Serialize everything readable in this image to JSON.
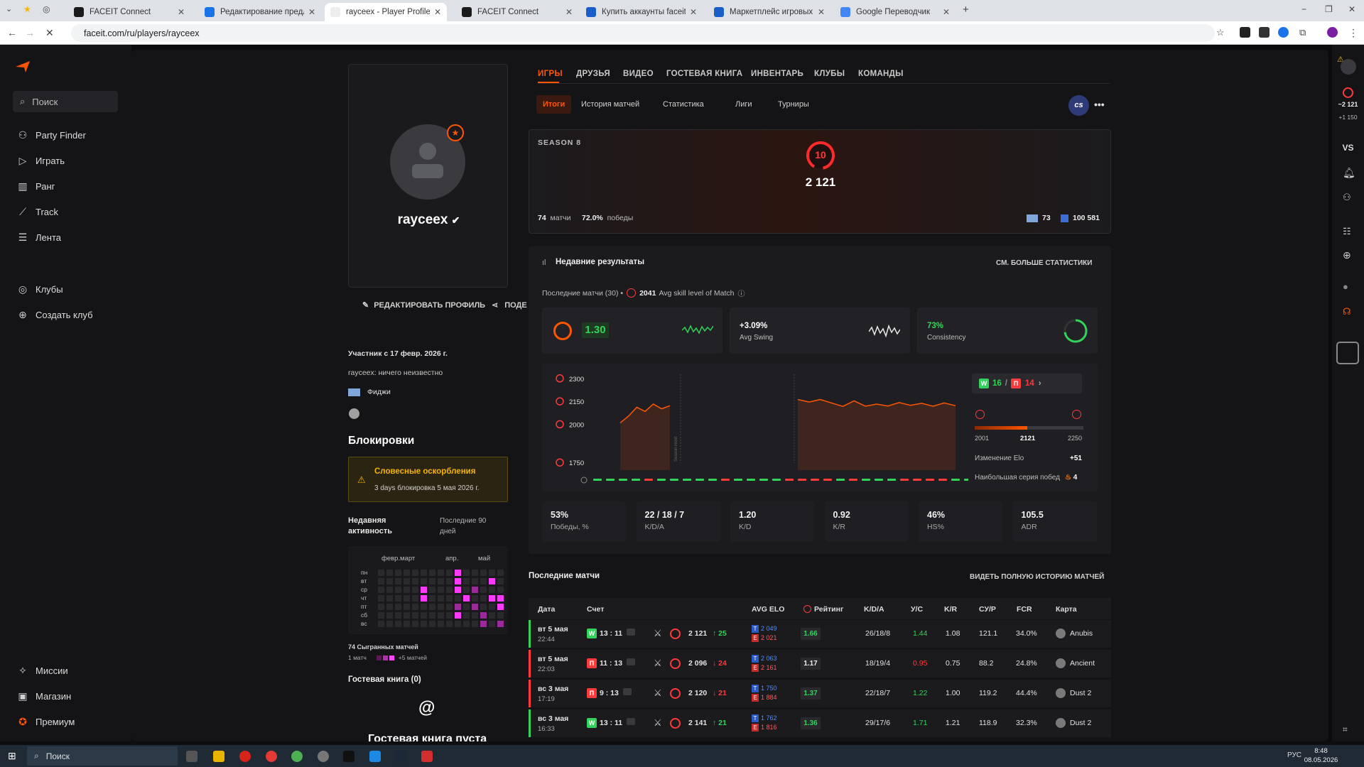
{
  "browser": {
    "tabs": [
      {
        "title": "FACEIT Connect",
        "active": false
      },
      {
        "title": "Редактирование предложения",
        "active": false
      },
      {
        "title": "rayceex - Player Profile - FACEIT",
        "active": true
      },
      {
        "title": "FACEIT Connect",
        "active": false
      },
      {
        "title": "Купить аккаунты faceit Counter",
        "active": false
      },
      {
        "title": "Маркетплейс игровых товаров",
        "active": false
      },
      {
        "title": "Google Переводчик",
        "active": false
      }
    ],
    "url": "faceit.com/ru/players/rayceex"
  },
  "sidebar": {
    "search_placeholder": "Поиск",
    "items": [
      {
        "label": "Party Finder",
        "icon": "party-icon"
      },
      {
        "label": "Играть",
        "icon": "play-icon"
      },
      {
        "label": "Ранг",
        "icon": "rank-icon"
      },
      {
        "label": "Track",
        "icon": "track-icon"
      },
      {
        "label": "Лента",
        "icon": "feed-icon"
      }
    ],
    "club_items": [
      {
        "label": "Клубы",
        "icon": "clubs-icon"
      },
      {
        "label": "Создать клуб",
        "icon": "create-club-icon"
      }
    ],
    "bottom_items": [
      {
        "label": "Миссии",
        "icon": "missions-icon"
      },
      {
        "label": "Магазин",
        "icon": "shop-icon"
      },
      {
        "label": "Премиум",
        "icon": "premium-icon"
      }
    ]
  },
  "profile": {
    "username": "rayceex",
    "edit_label": "РЕДАКТИРОВАТЬ ПРОФИЛЬ",
    "share_label": "ПОДЕ",
    "member_since": "Участник с 17 февр. 2026 г.",
    "bio": "rayceex: ничего неизвестно",
    "country": "Фиджи",
    "bans_title": "Блокировки",
    "ban_title": "Словесные оскорбления",
    "ban_desc": "3 days блокировка 5 мая 2026 г.",
    "activity_title": "Недавняя активность",
    "activity_period": "Последние 90 дней",
    "activity_months": [
      "февр.",
      "март",
      "апр.",
      "май"
    ],
    "activity_days": [
      "пн",
      "вт",
      "ср",
      "чт",
      "пт",
      "сб",
      "вс"
    ],
    "played_matches": "74 Сыгранных матчей",
    "legend_min": "1 матч",
    "legend_max": "+5 матчей",
    "guestbook_title": "Гостевая книга (0)",
    "guestbook_empty": "Гостевая книга пуста"
  },
  "tabs": {
    "main": [
      "ИГРЫ",
      "ДРУЗЬЯ",
      "ВИДЕО",
      "ГОСТЕВАЯ КНИГА",
      "ИНВЕНТАРЬ",
      "КЛУБЫ",
      "КОМАНДЫ"
    ],
    "sub": [
      "Итоги",
      "История матчей",
      "Статистика",
      "Лиги",
      "Турниры"
    ],
    "game_badge": "cs"
  },
  "season": {
    "label": "SEASON 8",
    "level": "10",
    "elo": "2 121",
    "matches": "74",
    "matches_label": "матчи",
    "winrate": "72.0%",
    "winrate_label": "победы",
    "country_rank": "73",
    "world_rank": "100 581"
  },
  "recent": {
    "title": "Недавние результаты",
    "more": "СМ. БОЛЬШЕ СТАТИСТИКИ",
    "subtitle_prefix": "Последние матчи (30) •",
    "avg_skill": "2041",
    "avg_skill_label": "Avg skill level of Match",
    "rating": "1.30",
    "swing": "+3.09%",
    "swing_label": "Avg Swing",
    "consistency": "73%",
    "consistency_label": "Consistency",
    "wins": "16",
    "losses": "14",
    "range_min": "2001",
    "range_cur": "2121",
    "range_max": "2250",
    "elo_change_label": "Изменение Elo",
    "elo_change": "+51",
    "streak_label": "Наибольшая серия побед",
    "streak": "4",
    "season_reset_label": "Season reset",
    "stats": [
      {
        "value": "53%",
        "label": "Победы, %"
      },
      {
        "value": "22 / 18 / 7",
        "label": "K/D/A"
      },
      {
        "value": "1.20",
        "label": "K/D"
      },
      {
        "value": "0.92",
        "label": "K/R"
      },
      {
        "value": "46%",
        "label": "HS%"
      },
      {
        "value": "105.5",
        "label": "ADR"
      }
    ]
  },
  "chart_data": {
    "type": "line",
    "ylabels": [
      "2300",
      "2150",
      "2000",
      "1750"
    ],
    "ylim": [
      1700,
      2350
    ],
    "series": [
      {
        "values": [
          2009,
          2053,
          2111,
          2084,
          2132,
          2101,
          2121
        ]
      },
      {
        "values": [
          2162,
          2145,
          2162,
          2139,
          2117,
          2153,
          2118,
          2132,
          2119,
          2142,
          2124,
          2137,
          2118,
          2139,
          2121
        ]
      }
    ],
    "results": [
      "W",
      "W",
      "W",
      "W",
      "L",
      "W",
      "W",
      "W",
      "W",
      "W",
      "L",
      "W",
      "W",
      "W",
      "W",
      "L",
      "L",
      "L",
      "L",
      "W",
      "L",
      "W",
      "W",
      "W",
      "L",
      "L",
      "L",
      "L",
      "W",
      "W"
    ],
    "colors": {
      "win": "#32d35a",
      "loss": "#ff3a3a",
      "line": "#ff5500"
    }
  },
  "matches": {
    "title": "Последние матчи",
    "all": "ВИДЕТЬ ПОЛНУЮ ИСТОРИЮ МАТЧЕЙ",
    "headers": [
      "Дата",
      "Счет",
      "AVG ELO",
      "Рейтинг",
      "K/D/A",
      "У/С",
      "K/R",
      "СУ/Р",
      "FCR",
      "Карта"
    ],
    "rows": [
      {
        "date": "вт 5 мая",
        "time": "22:44",
        "res": "W",
        "score": "13 : 11",
        "elo": "2 121",
        "delta": "↑ 25",
        "t": "2 049",
        "ct": "2 021",
        "rating": "1.66",
        "kda": "26/18/8",
        "kd": "1.44",
        "kr": "1.08",
        "adr": "121.1",
        "fcr": "34.0%",
        "map": "Anubis"
      },
      {
        "date": "вт 5 мая",
        "time": "22:03",
        "res": "П",
        "score": "11 : 13",
        "elo": "2 096",
        "delta": "↓ 24",
        "t": "2 063",
        "ct": "2 161",
        "rating": "1.17",
        "kda": "18/19/4",
        "kd": "0.95",
        "kr": "0.75",
        "adr": "88.2",
        "fcr": "24.8%",
        "map": "Ancient"
      },
      {
        "date": "вс 3 мая",
        "time": "17:19",
        "res": "П",
        "score": "9 : 13",
        "elo": "2 120",
        "delta": "↓ 21",
        "t": "1 750",
        "ct": "1 884",
        "rating": "1.37",
        "kda": "22/18/7",
        "kd": "1.22",
        "kr": "1.00",
        "adr": "119.2",
        "fcr": "44.4%",
        "map": "Dust 2"
      },
      {
        "date": "вс 3 мая",
        "time": "16:33",
        "res": "W",
        "score": "13 : 11",
        "elo": "2 141",
        "delta": "↑ 21",
        "t": "1 762",
        "ct": "1 816",
        "rating": "1.36",
        "kda": "29/17/6",
        "kd": "1.71",
        "kr": "1.21",
        "adr": "118.9",
        "fcr": "32.3%",
        "map": "Dust 2"
      }
    ]
  },
  "rightbar": {
    "elo": "~2 121",
    "delta": "+1 150",
    "vs": "VS"
  },
  "taskbar": {
    "search": "Поиск",
    "lang": "РУС",
    "time": "8:48",
    "date": "08.05.2026"
  }
}
